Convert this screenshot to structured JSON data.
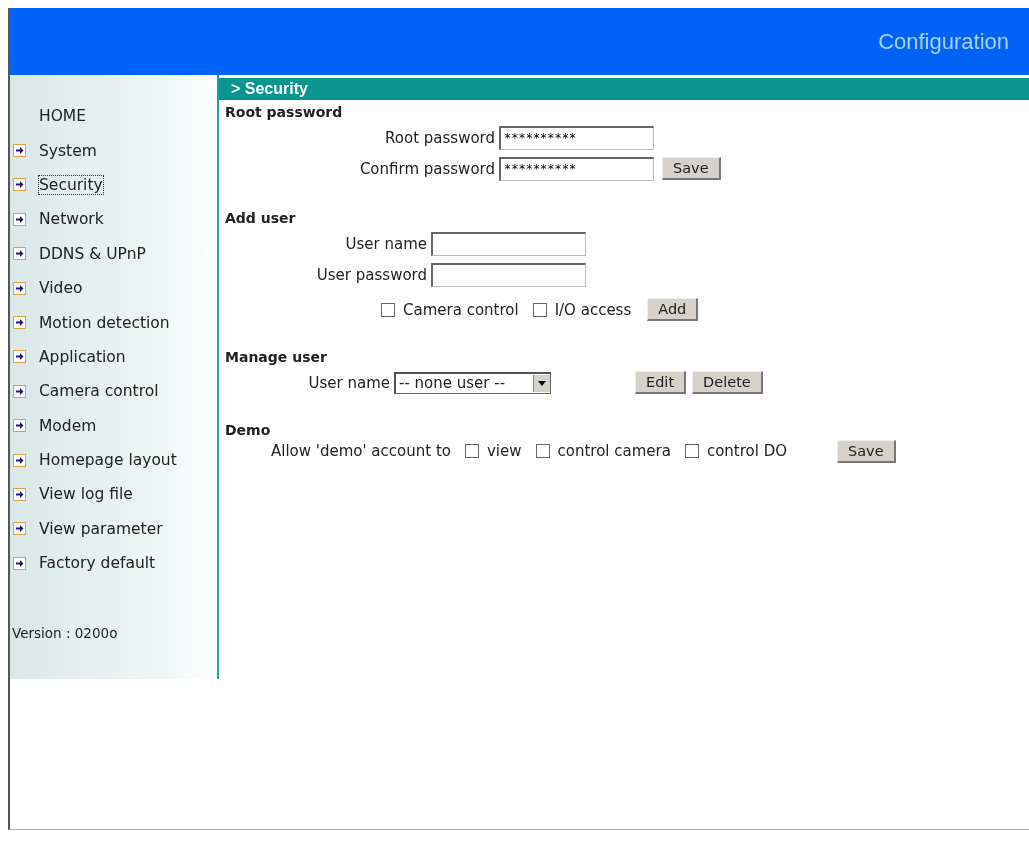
{
  "header": {
    "title": "Configuration"
  },
  "sidebar": {
    "items": [
      {
        "label": "HOME",
        "kind": "home",
        "selected": false
      },
      {
        "label": "System",
        "kind": "link",
        "selected": false
      },
      {
        "label": "Security",
        "kind": "link",
        "selected": true
      },
      {
        "label": "Network",
        "kind": "link",
        "selected": false
      },
      {
        "label": "DDNS & UPnP",
        "kind": "link",
        "selected": false
      },
      {
        "label": "Video",
        "kind": "link",
        "selected": false
      },
      {
        "label": "Motion detection",
        "kind": "link",
        "selected": false
      },
      {
        "label": "Application",
        "kind": "link",
        "selected": false
      },
      {
        "label": "Camera control",
        "kind": "link",
        "selected": false
      },
      {
        "label": "Modem",
        "kind": "link",
        "selected": false
      },
      {
        "label": "Homepage layout",
        "kind": "link",
        "selected": false
      },
      {
        "label": "View log file",
        "kind": "link",
        "selected": false
      },
      {
        "label": "View parameter",
        "kind": "link",
        "selected": false
      },
      {
        "label": "Factory default",
        "kind": "link",
        "selected": false
      }
    ],
    "version": "Version : 0200o"
  },
  "page_title": "> Security",
  "root_password": {
    "heading": "Root password",
    "root_label": "Root password",
    "root_value": "**********",
    "confirm_label": "Confirm password",
    "confirm_value": "**********",
    "button": "Save"
  },
  "add_user": {
    "heading": "Add user",
    "name_label": "User name",
    "password_label": "User password",
    "options": [
      {
        "label": "Camera control",
        "checked": false
      },
      {
        "label": "I/O access",
        "checked": false
      }
    ],
    "button": "Add"
  },
  "manage_user": {
    "heading": "Manage user",
    "name_label": "User name",
    "selected_user": "-- none user --",
    "buttons": [
      "Edit",
      "Delete"
    ]
  },
  "demo": {
    "heading": "Demo",
    "label": "Allow 'demo' account to",
    "options": [
      {
        "label": "view",
        "checked": false
      },
      {
        "label": "control camera",
        "checked": false
      },
      {
        "label": "control DO",
        "checked": false
      }
    ],
    "button": "Save"
  }
}
